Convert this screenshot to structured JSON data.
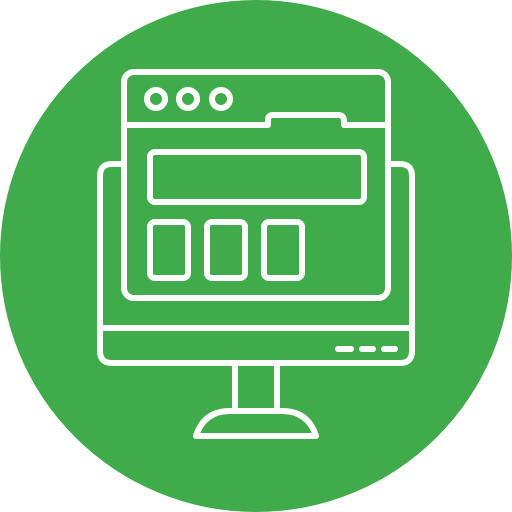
{
  "icon": {
    "name": "web-app-on-monitor-icon",
    "colors": {
      "background": "#3fab4b",
      "stroke": "#ffffff"
    },
    "browser_window": {
      "title_bar_dots": 3,
      "tab_shape": "folder-tab"
    },
    "app_layout": {
      "header_bar": 1,
      "content_blocks": 3
    },
    "monitor": {
      "status_indicators": 3
    }
  }
}
